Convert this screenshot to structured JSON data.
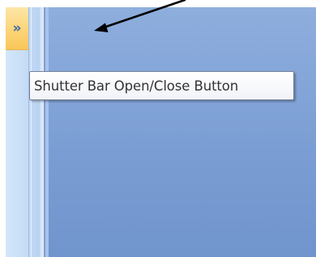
{
  "nav_pane": {
    "shutter_button": {
      "glyph": "»",
      "icon": "double-chevron-right-icon"
    }
  },
  "tooltip": {
    "text": "Shutter Bar Open/Close Button"
  },
  "annotation": {
    "icon": "arrow-pointer-icon",
    "color": "#000000"
  },
  "colors": {
    "workspace": "#7b9ed4",
    "nav_pane": "#c6dcf6",
    "shutter_button": "#fcd67b",
    "chevron": "#3a6aa8"
  }
}
